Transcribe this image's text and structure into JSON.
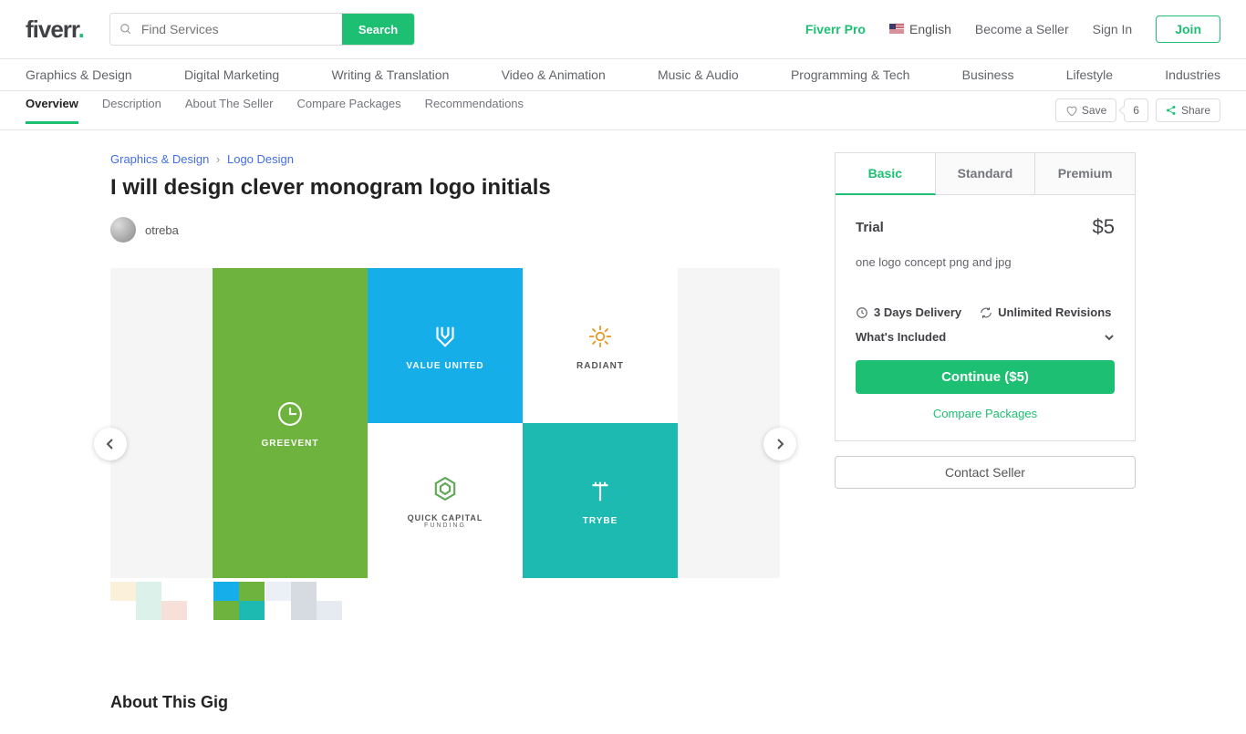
{
  "header": {
    "logo_text": "fiverr",
    "search_placeholder": "Find Services",
    "search_button": "Search",
    "pro": "Fiverr Pro",
    "language": "English",
    "become_seller": "Become a Seller",
    "sign_in": "Sign In",
    "join": "Join"
  },
  "categories": [
    "Graphics & Design",
    "Digital Marketing",
    "Writing & Translation",
    "Video & Animation",
    "Music & Audio",
    "Programming & Tech",
    "Business",
    "Lifestyle",
    "Industries"
  ],
  "subnav": {
    "tabs": [
      "Overview",
      "Description",
      "About The Seller",
      "Compare Packages",
      "Recommendations"
    ],
    "save": "Save",
    "save_count": "6",
    "share": "Share"
  },
  "breadcrumb": {
    "cat": "Graphics & Design",
    "sub": "Logo Design"
  },
  "gig": {
    "title": "I will design clever monogram logo initials",
    "seller": "otreba"
  },
  "showcase": {
    "vu": "VALUE UNITED",
    "gv": "GREEVENT",
    "rd": "RADIANT",
    "qc_line1": "QUICK CAPITAL",
    "qc_line2": "FUNDING",
    "tr": "TRYBE"
  },
  "package": {
    "tabs": [
      "Basic",
      "Standard",
      "Premium"
    ],
    "name": "Trial",
    "price": "$5",
    "description": "one logo concept png and jpg",
    "delivery": "3 Days Delivery",
    "revisions": "Unlimited Revisions",
    "included_label": "What's Included",
    "continue": "Continue ($5)",
    "compare": "Compare Packages",
    "contact": "Contact Seller"
  },
  "about_heading": "About This Gig"
}
